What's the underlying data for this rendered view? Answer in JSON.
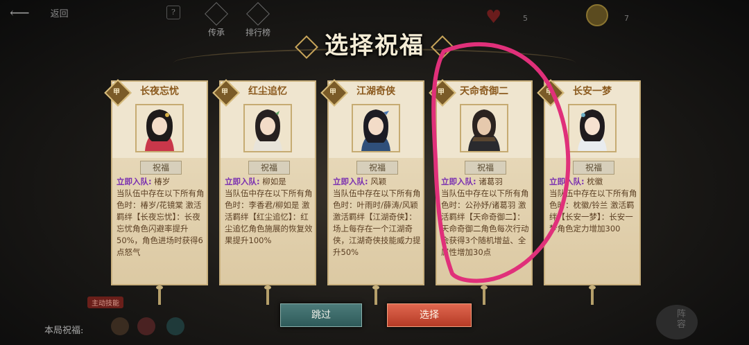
{
  "topbar": {
    "back_label": "返回",
    "nav": [
      {
        "label": "传承"
      },
      {
        "label": "排行榜"
      }
    ],
    "heart_count": "5",
    "coin_count": "7"
  },
  "title": "选择祝福",
  "cards": [
    {
      "badge": "甲",
      "name": "长夜忘忧",
      "bless_label": "祝福",
      "join_label": "立即入队:",
      "join_name": "椿岁",
      "body": "当队伍中存在以下所有角色时：椿岁/花镜棠 激活羁绊【长夜忘忧】：长夜忘忧角色闪避率提升50%，角色进场时获得6点怒气"
    },
    {
      "badge": "甲",
      "name": "红尘追忆",
      "bless_label": "祝福",
      "join_label": "立即入队:",
      "join_name": "柳如是",
      "body": "当队伍中存在以下所有角色时：李香君/柳如是 激活羁绊【红尘追忆】：红尘追忆角色施展的恢复效果提升100%"
    },
    {
      "badge": "甲",
      "name": "江湖奇侠",
      "bless_label": "祝福",
      "join_label": "立即入队:",
      "join_name": "风颖",
      "body": "当队伍中存在以下所有角色时：叶雨时/薛涛/风颖 激活羁绊【江湖奇侠】：场上每存在一个江湖奇侠，江湖奇侠技能威力提升50%"
    },
    {
      "badge": "甲",
      "name": "天命奇御二",
      "bless_label": "祝福",
      "join_label": "立即入队:",
      "join_name": "诸葛羽",
      "body": "当队伍中存在以下所有角色时：公孙妤/诸葛羽 激活羁绊【天命奇御二】：天命奇御二角色每次行动会获得3个随机增益、全属性增加30点"
    },
    {
      "badge": "甲",
      "name": "长安一梦",
      "bless_label": "祝福",
      "join_label": "立即入队:",
      "join_name": "枕徽",
      "body": "当队伍中存在以下所有角色时：枕徽/铃兰 激活羁绊【长安一梦】：长安一梦角色定力增加300"
    }
  ],
  "buttons": {
    "skip": "跳过",
    "select": "选择"
  },
  "footer": {
    "round_blessing_label": "本局祝福:",
    "skill_tag": "主动技能",
    "lineup_label": "阵容"
  },
  "colors": {
    "card_bg": "#efe5cf",
    "join_purple": "#7a2fb0",
    "select_red": "#c64a33",
    "skip_teal": "#3f6e6d",
    "annotation_pink": "#e0307a"
  }
}
